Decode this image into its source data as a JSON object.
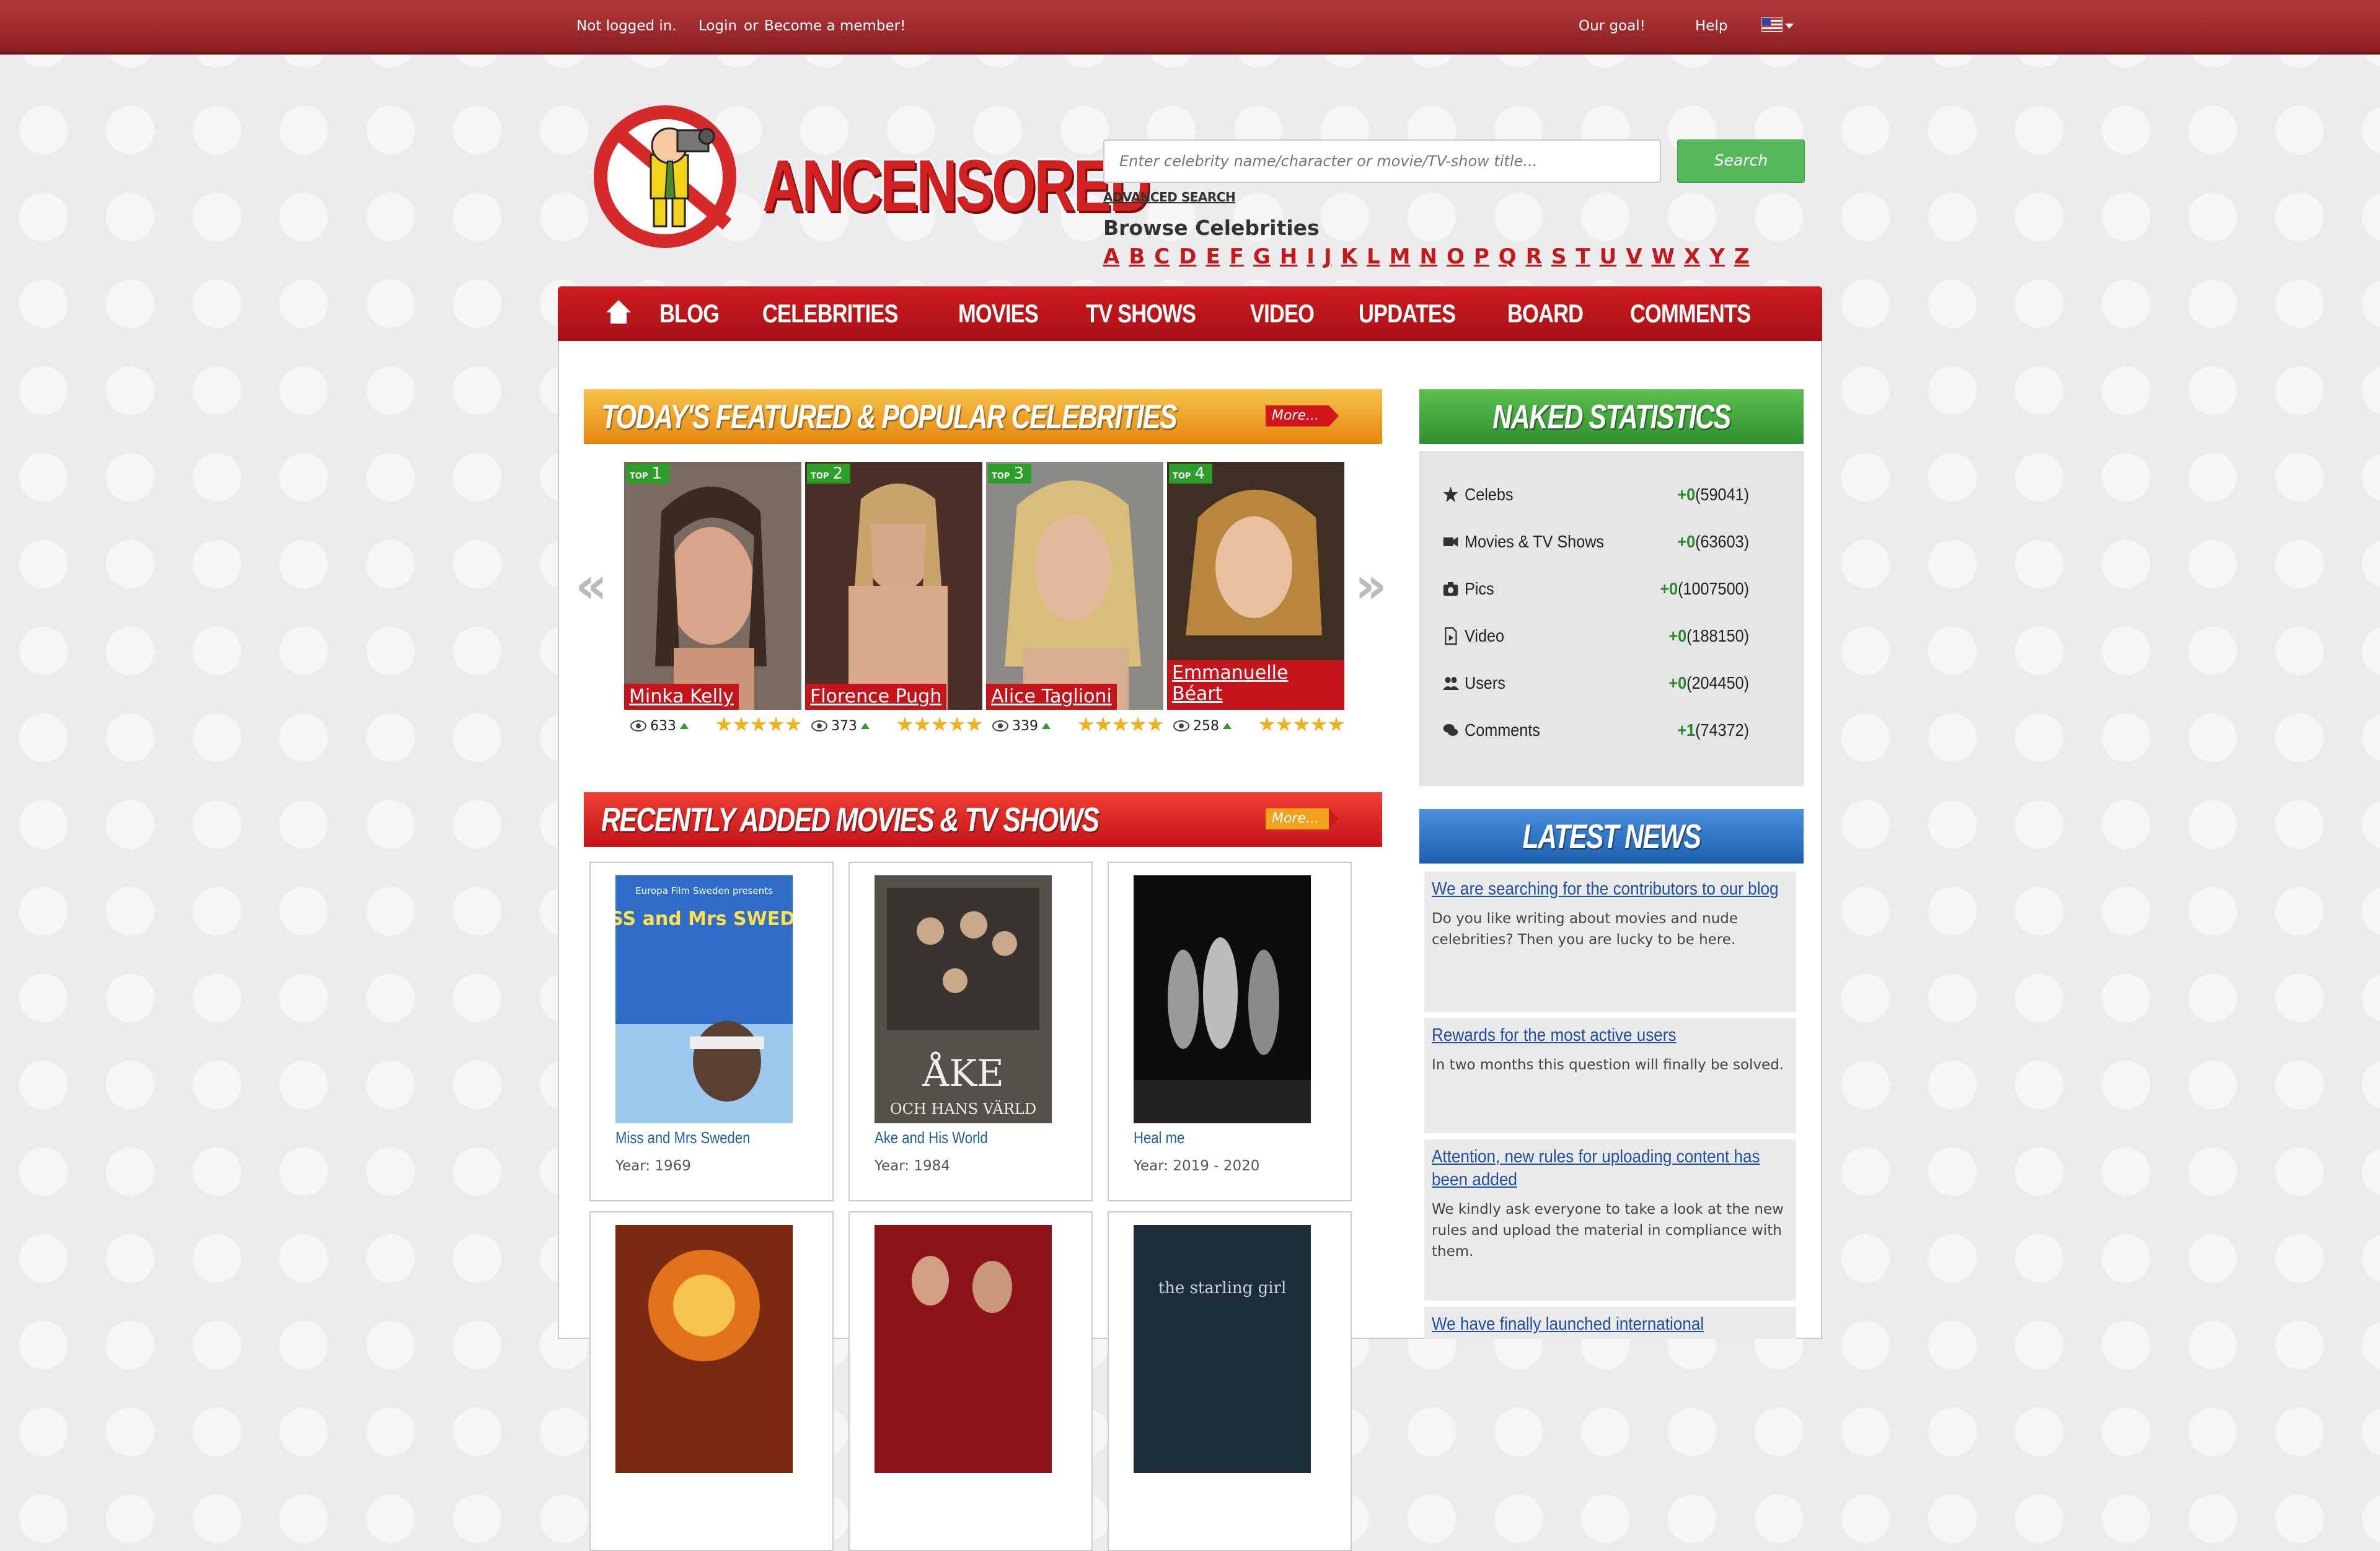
{
  "topbar": {
    "status": "Not logged in.",
    "login": "Login",
    "or": "or",
    "become": "Become a member!",
    "goal": "Our goal!",
    "help": "Help"
  },
  "logo": {
    "text": "ANCENSORED"
  },
  "search": {
    "placeholder": "Enter celebrity name/character or movie/TV-show title...",
    "button": "Search",
    "advanced": "ADVANCED SEARCH"
  },
  "browse": {
    "title": "Browse Celebrities",
    "letters": [
      "A",
      "B",
      "C",
      "D",
      "E",
      "F",
      "G",
      "H",
      "I",
      "J",
      "K",
      "L",
      "M",
      "N",
      "O",
      "P",
      "Q",
      "R",
      "S",
      "T",
      "U",
      "V",
      "W",
      "X",
      "Y",
      "Z"
    ]
  },
  "nav": {
    "items": [
      "BLOG",
      "CELEBRITIES",
      "MOVIES",
      "TV SHOWS",
      "VIDEO",
      "UPDATES",
      "BOARD",
      "COMMENTS"
    ]
  },
  "featured": {
    "title": "TODAY'S FEATURED & POPULAR CELEBRITIES",
    "more": "More...",
    "celebs": [
      {
        "rank_label": "TOP",
        "rank": "1",
        "name": "Minka Kelly",
        "views": "633",
        "rating": 5
      },
      {
        "rank_label": "TOP",
        "rank": "2",
        "name": "Florence Pugh",
        "views": "373",
        "rating": 4.5
      },
      {
        "rank_label": "TOP",
        "rank": "3",
        "name": "Alice Taglioni",
        "views": "339",
        "rating": 4.5
      },
      {
        "rank_label": "TOP",
        "rank": "4",
        "name": "Emmanuelle Béart",
        "views": "258",
        "rating": 5
      }
    ]
  },
  "stats": {
    "title": "NAKED STATISTICS",
    "rows": [
      {
        "icon": "star-icon",
        "label": "Celebs",
        "delta": "+0",
        "total": "(59041)"
      },
      {
        "icon": "video-camera-icon",
        "label": "Movies & TV Shows",
        "delta": "+0",
        "total": "(63603)"
      },
      {
        "icon": "camera-icon",
        "label": "Pics",
        "delta": "+0",
        "total": "(1007500)"
      },
      {
        "icon": "video-file-icon",
        "label": "Video",
        "delta": "+0",
        "total": "(188150)"
      },
      {
        "icon": "users-icon",
        "label": "Users",
        "delta": "+0",
        "total": "(204450)"
      },
      {
        "icon": "comments-icon",
        "label": "Comments",
        "delta": "+1",
        "total": "(74372)"
      }
    ]
  },
  "recent": {
    "title": "RECENTLY ADDED MOVIES & TV SHOWS",
    "more": "More...",
    "movies": [
      {
        "title": "Miss and Mrs Sweden",
        "year": "Year: 1969",
        "poster_top": "Europa Film Sweden presents",
        "poster_big": "MISS and Mrs SWEDEN"
      },
      {
        "title": "Ake and His World",
        "year": "Year: 1984",
        "poster_big": "ÅKE",
        "poster_sub": "OCH HANS VÄRLD"
      },
      {
        "title": "Heal me",
        "year": "Year: 2019 - 2020"
      }
    ],
    "more_posters": [
      {
        "text": ""
      },
      {
        "text": ""
      },
      {
        "text": "the starling girl"
      }
    ]
  },
  "news": {
    "title": "LATEST NEWS",
    "items": [
      {
        "title": "We are searching for the contributors to our blog",
        "body": "Do you like writing about movies and nude celebrities? Then you are lucky to be here."
      },
      {
        "title": "Rewards for the most active users",
        "body": "In two months this question will finally be solved."
      },
      {
        "title": "Attention, new rules for uploading content has been added",
        "body": "We kindly ask everyone to take a look at the new rules and upload the material in compliance with them."
      },
      {
        "title": "We have finally launched international",
        "body": ""
      }
    ]
  },
  "colors": {
    "brand_red": "#c5141a",
    "featured_header": "#f3a11d",
    "stats_header": "#3a9e3a",
    "news_header": "#2f74c0",
    "recent_header": "#d3151b"
  }
}
